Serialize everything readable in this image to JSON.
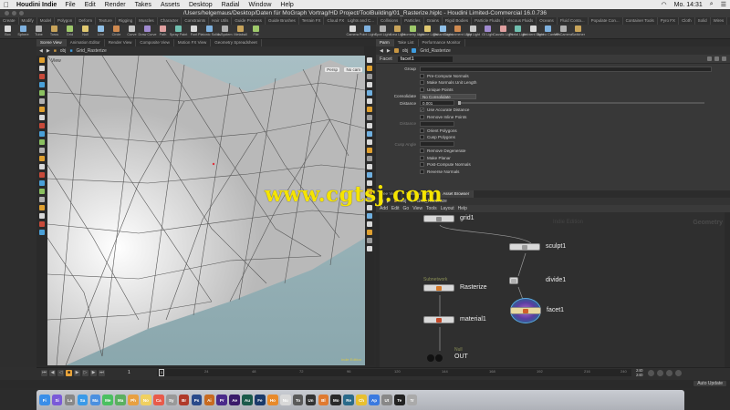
{
  "menubar": {
    "app": "Houdini Indie",
    "items": [
      "File",
      "Edit",
      "Render",
      "Takes",
      "Assets",
      "Desktop",
      "Radial",
      "Window",
      "Help"
    ],
    "clock": "Mo. 14:31"
  },
  "window_title": "/Users/helgemaus/Desktop/Daten für MoGraph Vortrag/HD Project/ToolBuilding/01_Rasterize.hiplc - Houdini Limited-Commercial 16.0.736",
  "shelf_left": {
    "tabs": [
      "Create",
      "Modify",
      "Model",
      "Polygon",
      "Deform",
      "Texture",
      "Rigging",
      "Muscles",
      "Character",
      "Constraints",
      "Hair Utils",
      "Guide Process",
      "Guide Brushes",
      "Terrain FX",
      "Cloud FX",
      "Volume"
    ],
    "tools": [
      "Box",
      "Sphere",
      "Tube",
      "Torus",
      "Grid",
      "Null",
      "Line",
      "Circle",
      "Curve",
      "Draw Curve",
      "Path",
      "Spray Paint",
      "Font",
      "Platonic Solids",
      "L-System",
      "Metaball",
      "File"
    ]
  },
  "shelf_right": {
    "tabs": [
      "Lights and C...",
      "Collisions",
      "Particles",
      "Grains",
      "Rigid Bodies",
      "Particle Fluids",
      "Viscous Fluids",
      "Oceans",
      "Fluid Conta...",
      "Populate Con...",
      "Container Tools",
      "Pyro FX",
      "Cloth",
      "Solid",
      "Wires",
      "Crowds",
      "Drive Simula..."
    ],
    "tools": [
      "Camera",
      "Point Light",
      "Spot Light",
      "Area Light",
      "Geometry Light",
      "Volume Light",
      "Distant Light",
      "Environment Light",
      "Sky Light",
      "GI Light",
      "Caustic Light",
      "Portal Light",
      "Ambient Light",
      "Stereo Camera",
      "VR Camera",
      "Switcher"
    ]
  },
  "viewport_tabs": [
    "Scene View",
    "Animation Editor",
    "Render View",
    "Composite View",
    "Motion FX View",
    "Geometry Spreadsheet"
  ],
  "viewport": {
    "path_obj": "obj",
    "path_node": "Grid_Rasterize",
    "view_label": "View",
    "persp": "Persp",
    "cam": "No cam",
    "corner_label": "Indie Edition"
  },
  "param_tabs": [
    "Parm",
    "Take List",
    "Performance Monitor"
  ],
  "param": {
    "path_obj": "obj",
    "path_node": "Grid_Rasterize",
    "node_type": "Facet",
    "node_name": "facet1",
    "group_label": "Group",
    "pre_compute_normals": "Pre-Compute Normals",
    "make_normals_unit": "Make Normals Unit Length",
    "unique_points": "Unique Points",
    "consolidate_label": "Consolidate",
    "consolidate_value": "No Consolidate",
    "distance_label": "Distance",
    "distance_value": "0.001",
    "use_accurate": "Use Accurate Distance",
    "remove_inline": "Remove Inline Points",
    "distance_label2": "Distance",
    "orient_polygons": "Orient Polygons",
    "cusp_polygons": "Cusp Polygons",
    "cusp_angle_label": "Cusp Angle",
    "remove_degenerate": "Remove Degenerate",
    "make_planar": "Make Planar",
    "post_compute_normals": "Post-Compute Normals",
    "reverse_normals": "Reverse Normals"
  },
  "network_tabs": [
    "Tree View",
    "Material Palette",
    "Asset Browser"
  ],
  "network": {
    "path_obj": "obj",
    "path_node": "Grid_Rasterize",
    "menu": [
      "Add",
      "Edit",
      "Go",
      "View",
      "Tools",
      "Layout",
      "Help"
    ],
    "title": "Indie Edition",
    "context": "Geometry",
    "nodes": {
      "grid": "grid1",
      "sculpt": "sculpt1",
      "divide": "divide1",
      "rasterize": "Rasterize",
      "rasterize_sub": "Subnetwork",
      "material": "material1",
      "facet": "facet1",
      "null_sub": "Null",
      "out": "OUT"
    }
  },
  "timeline": {
    "frame": "1",
    "ticks": [
      "1",
      "24",
      "48",
      "72",
      "96",
      "120",
      "144",
      "168",
      "192",
      "216",
      "240"
    ],
    "range_end": "240",
    "range_end2": "240",
    "current": "1"
  },
  "status": {
    "auto_update": "Auto Update"
  },
  "watermark": "www.cgtsj.com",
  "dock_icons": [
    "Finder",
    "Siri",
    "Launchpad",
    "Safari",
    "Mail",
    "Messages",
    "Maps",
    "Photos",
    "Notes",
    "Calendar",
    "System",
    "Br",
    "Ps",
    "Ai",
    "Pr",
    "Ae",
    "Au",
    "Fe",
    "Hou",
    "Nuke",
    "Tools",
    "Unity",
    "Blender",
    "Mocha",
    "Reso",
    "Chrome",
    "App",
    "Util",
    "Terminal",
    "Trash"
  ],
  "colors": {
    "watermark": "#f5e400",
    "facet_ring": "#5aa8d8",
    "grid_sky_top": "#a8bfc4",
    "node_body": "#d9d9d9"
  }
}
